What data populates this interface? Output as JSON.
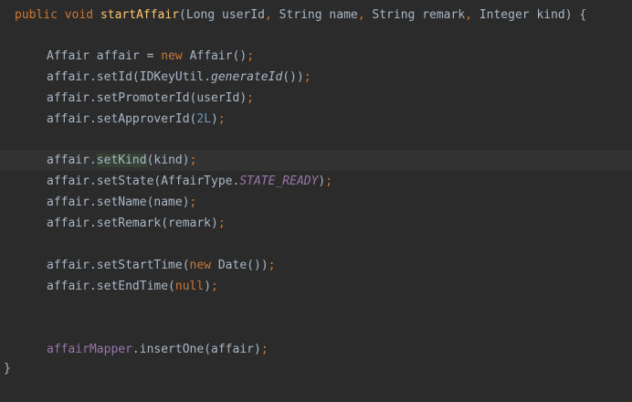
{
  "editor": {
    "lines": {
      "l1": {
        "kw_public": "public",
        "kw_void": "void",
        "method": "startAffair",
        "p_open": "(",
        "t_long": "Long",
        "n_userid": "userId",
        "c1": ",",
        "t_string1": "String",
        "n_name": "name",
        "c2": ",",
        "t_string2": "String",
        "n_remark": "remark",
        "c3": ",",
        "t_integer": "Integer",
        "n_kind": "kind",
        "p_close": ")",
        "brace": "{"
      },
      "l2": {
        "type": "Affair",
        "var": "affair",
        "eq": "=",
        "kw_new": "new",
        "ctor": "Affair()",
        "semi": ";"
      },
      "l3": {
        "call": "affair.setId(IDKeyUtil.",
        "italic": "generateId",
        "tail": "())",
        "semi": ";"
      },
      "l4": {
        "call": "affair.setPromoterId(userId)",
        "semi": ";"
      },
      "l5": {
        "call": "affair.setApproverId(",
        "num": "2L",
        "close": ")",
        "semi": ";"
      },
      "l6": {
        "pre": "affair.",
        "hl": "setKind",
        "post": "(kind)",
        "semi": ";"
      },
      "l7": {
        "call": "affair.setState(AffairType.",
        "static": "STATE_READY",
        "close": ")",
        "semi": ";"
      },
      "l8": {
        "call": "affair.setName(name)",
        "semi": ";"
      },
      "l9": {
        "call": "affair.setRemark(remark)",
        "semi": ";"
      },
      "l10": {
        "call": "affair.setStartTime(",
        "kw_new": "new",
        "ctor": " Date())",
        "semi": ";"
      },
      "l11": {
        "call": "affair.setEndTime(",
        "kw_null": "null",
        "close": ")",
        "semi": ";"
      },
      "l12": {
        "field": "affairMapper",
        "call": ".insertOne(affair)",
        "semi": ";"
      },
      "l13": {
        "brace": "}"
      }
    }
  }
}
